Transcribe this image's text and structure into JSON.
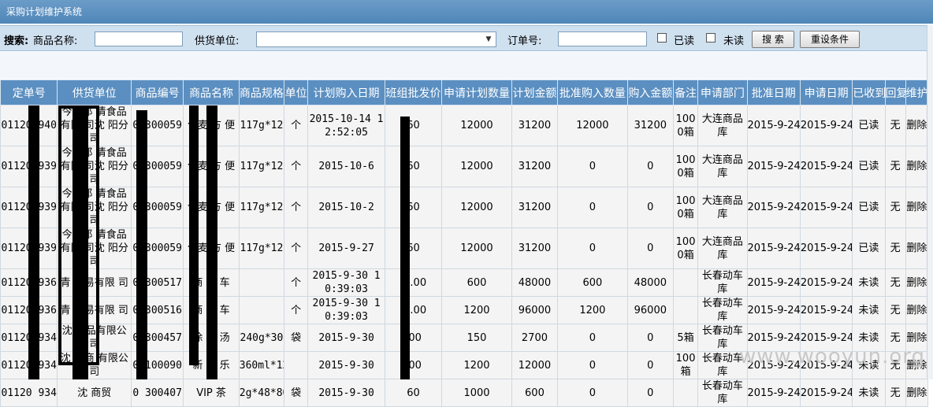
{
  "window": {
    "title": "采购计划维护系统"
  },
  "search": {
    "prefix": "搜索:",
    "product_name_label": "商品名称:",
    "product_name_value": "",
    "supplier_label": "供货单位:",
    "supplier_value": "",
    "order_no_label": "订单号:",
    "order_no_value": "",
    "read_label": "已读",
    "unread_label": "未读",
    "search_button": "搜 索",
    "reset_button": "重设条件"
  },
  "table": {
    "columns": [
      "定单号",
      "供货单位",
      "商品编号",
      "商品名称",
      "商品规格",
      "单位",
      "计划购入日期",
      "班组批发价",
      "申请计划数量",
      "计划金额",
      "批准购入数量",
      "购入金额",
      "备注",
      "申请部门",
      "批准日期",
      "申请日期",
      "已收到",
      "回复",
      "维护"
    ],
    "rows": [
      {
        "order": "01120 940",
        "supplier": "今麦郎 清食品有限 司沈 阳分 司",
        "code": "0 300059",
        "name": "今麦 方 便",
        "spec": "117g*12",
        "unit": "个",
        "plan_date": "2015-10-14 12:52:05",
        "price": "60",
        "apply_qty": "12000",
        "plan_amt": "31200",
        "approve_qty": "12000",
        "buy_amt": "31200",
        "note": "1000箱",
        "dept": "大连商品库",
        "approve_date": "2015-9-24",
        "apply_date": "2015-9-24",
        "received": "已读",
        "reply": "无",
        "action": "删除"
      },
      {
        "order": "01120 939",
        "supplier": "今麦郎 清食品有限 司沈 阳分 司",
        "code": "0 300059",
        "name": "今麦 方 便",
        "spec": "117g*12",
        "unit": "个",
        "plan_date": "2015-10-6",
        "price": "60",
        "apply_qty": "12000",
        "plan_amt": "31200",
        "approve_qty": "0",
        "buy_amt": "0",
        "note": "1000箱",
        "dept": "大连商品库",
        "approve_date": "2015-9-24",
        "apply_date": "2015-9-24",
        "received": "已读",
        "reply": "无",
        "action": "删除"
      },
      {
        "order": "01120 939",
        "supplier": "今麦郎 清食品有限 司沈 阳分 司",
        "code": "0 300059",
        "name": "今麦 方 便",
        "spec": "117g*12",
        "unit": "个",
        "plan_date": "2015-10-2",
        "price": "60",
        "apply_qty": "12000",
        "plan_amt": "31200",
        "approve_qty": "0",
        "buy_amt": "0",
        "note": "1000箱",
        "dept": "大连商品库",
        "approve_date": "2015-9-24",
        "apply_date": "2015-9-24",
        "received": "已读",
        "reply": "无",
        "action": "删除"
      },
      {
        "order": "01120 939",
        "supplier": "今麦郎 清食品有限 司沈 阳分 司",
        "code": "0 300059",
        "name": "今麦 方 便",
        "spec": "117g*12",
        "unit": "个",
        "plan_date": "2015-9-27",
        "price": "60",
        "apply_qty": "12000",
        "plan_amt": "31200",
        "approve_qty": "0",
        "buy_amt": "0",
        "note": "1000箱",
        "dept": "大连商品库",
        "approve_date": "2015-9-24",
        "apply_date": "2015-9-24",
        "received": "已读",
        "reply": "无",
        "action": "删除"
      },
      {
        "order": "01120 936",
        "supplier": "青 贸易有限 司",
        "code": "0 300517",
        "name": "商 模 车",
        "spec": "",
        "unit": "个",
        "plan_date": "2015-9-30 10:39:03",
        "price": "8 .00",
        "apply_qty": "600",
        "plan_amt": "48000",
        "approve_qty": "600",
        "buy_amt": "48000",
        "note": "",
        "dept": "长春动车库",
        "approve_date": "2015-9-24",
        "apply_date": "2015-9-24",
        "received": "未读",
        "reply": "无",
        "action": "删除"
      },
      {
        "order": "01120 936",
        "supplier": "青 贸易有限 司",
        "code": "0 300516",
        "name": "商 模 车",
        "spec": "",
        "unit": "个",
        "plan_date": "2015-9-30 10:39:03",
        "price": "8 .00",
        "apply_qty": "1200",
        "plan_amt": "96000",
        "approve_qty": "1200",
        "buy_amt": "96000",
        "note": "",
        "dept": "长春动车库",
        "approve_date": "2015-9-24",
        "apply_date": "2015-9-24",
        "received": "未读",
        "reply": "无",
        "action": "删除"
      },
      {
        "order": "01120 934",
        "supplier": "沈 食品有限公司",
        "code": "0 300457",
        "name": "徐 胡 汤",
        "spec": "240g*30",
        "unit": "袋",
        "plan_date": "2015-9-30",
        "price": " .00",
        "apply_qty": "150",
        "plan_amt": "2700",
        "approve_qty": "0",
        "buy_amt": "0",
        "note": "5箱",
        "dept": "长春动车库",
        "approve_date": "2015-9-24",
        "apply_date": "2015-9-24",
        "received": "未读",
        "reply": "无",
        "action": "删除"
      },
      {
        "order": "01120 934",
        "supplier": "沈 捷商 有限公司",
        "code": "0 100090",
        "name": "新 优 乐",
        "spec": "360ml*12",
        "unit": "",
        "plan_date": "2015-9-30",
        "price": " .00",
        "apply_qty": "1200",
        "plan_amt": "12000",
        "approve_qty": "0",
        "buy_amt": "0",
        "note": "100箱",
        "dept": "长春动车库",
        "approve_date": "2015-9-24",
        "apply_date": "2015-9-24",
        "received": "未读",
        "reply": "无",
        "action": "删除"
      },
      {
        "order": "01120 934",
        "supplier": "沈 商贸",
        "code": "0 300407",
        "name": "VIP 茶",
        "spec": "2g*48*80",
        "unit": "袋",
        "plan_date": "2015-9-30",
        "price": "60",
        "apply_qty": "1000",
        "plan_amt": "600",
        "approve_qty": "0",
        "buy_amt": "0",
        "note": "",
        "dept": "长春动车库",
        "approve_date": "2015-9-24",
        "apply_date": "2015-9-24",
        "received": "未读",
        "reply": "无",
        "action": "删除"
      }
    ]
  },
  "watermark": "www.wooyun.org",
  "colors": {
    "header": "#5b8fc1",
    "titlebar": "#4f86b8",
    "searchbar": "#cfe0ef",
    "row": "#f4f4f4"
  }
}
